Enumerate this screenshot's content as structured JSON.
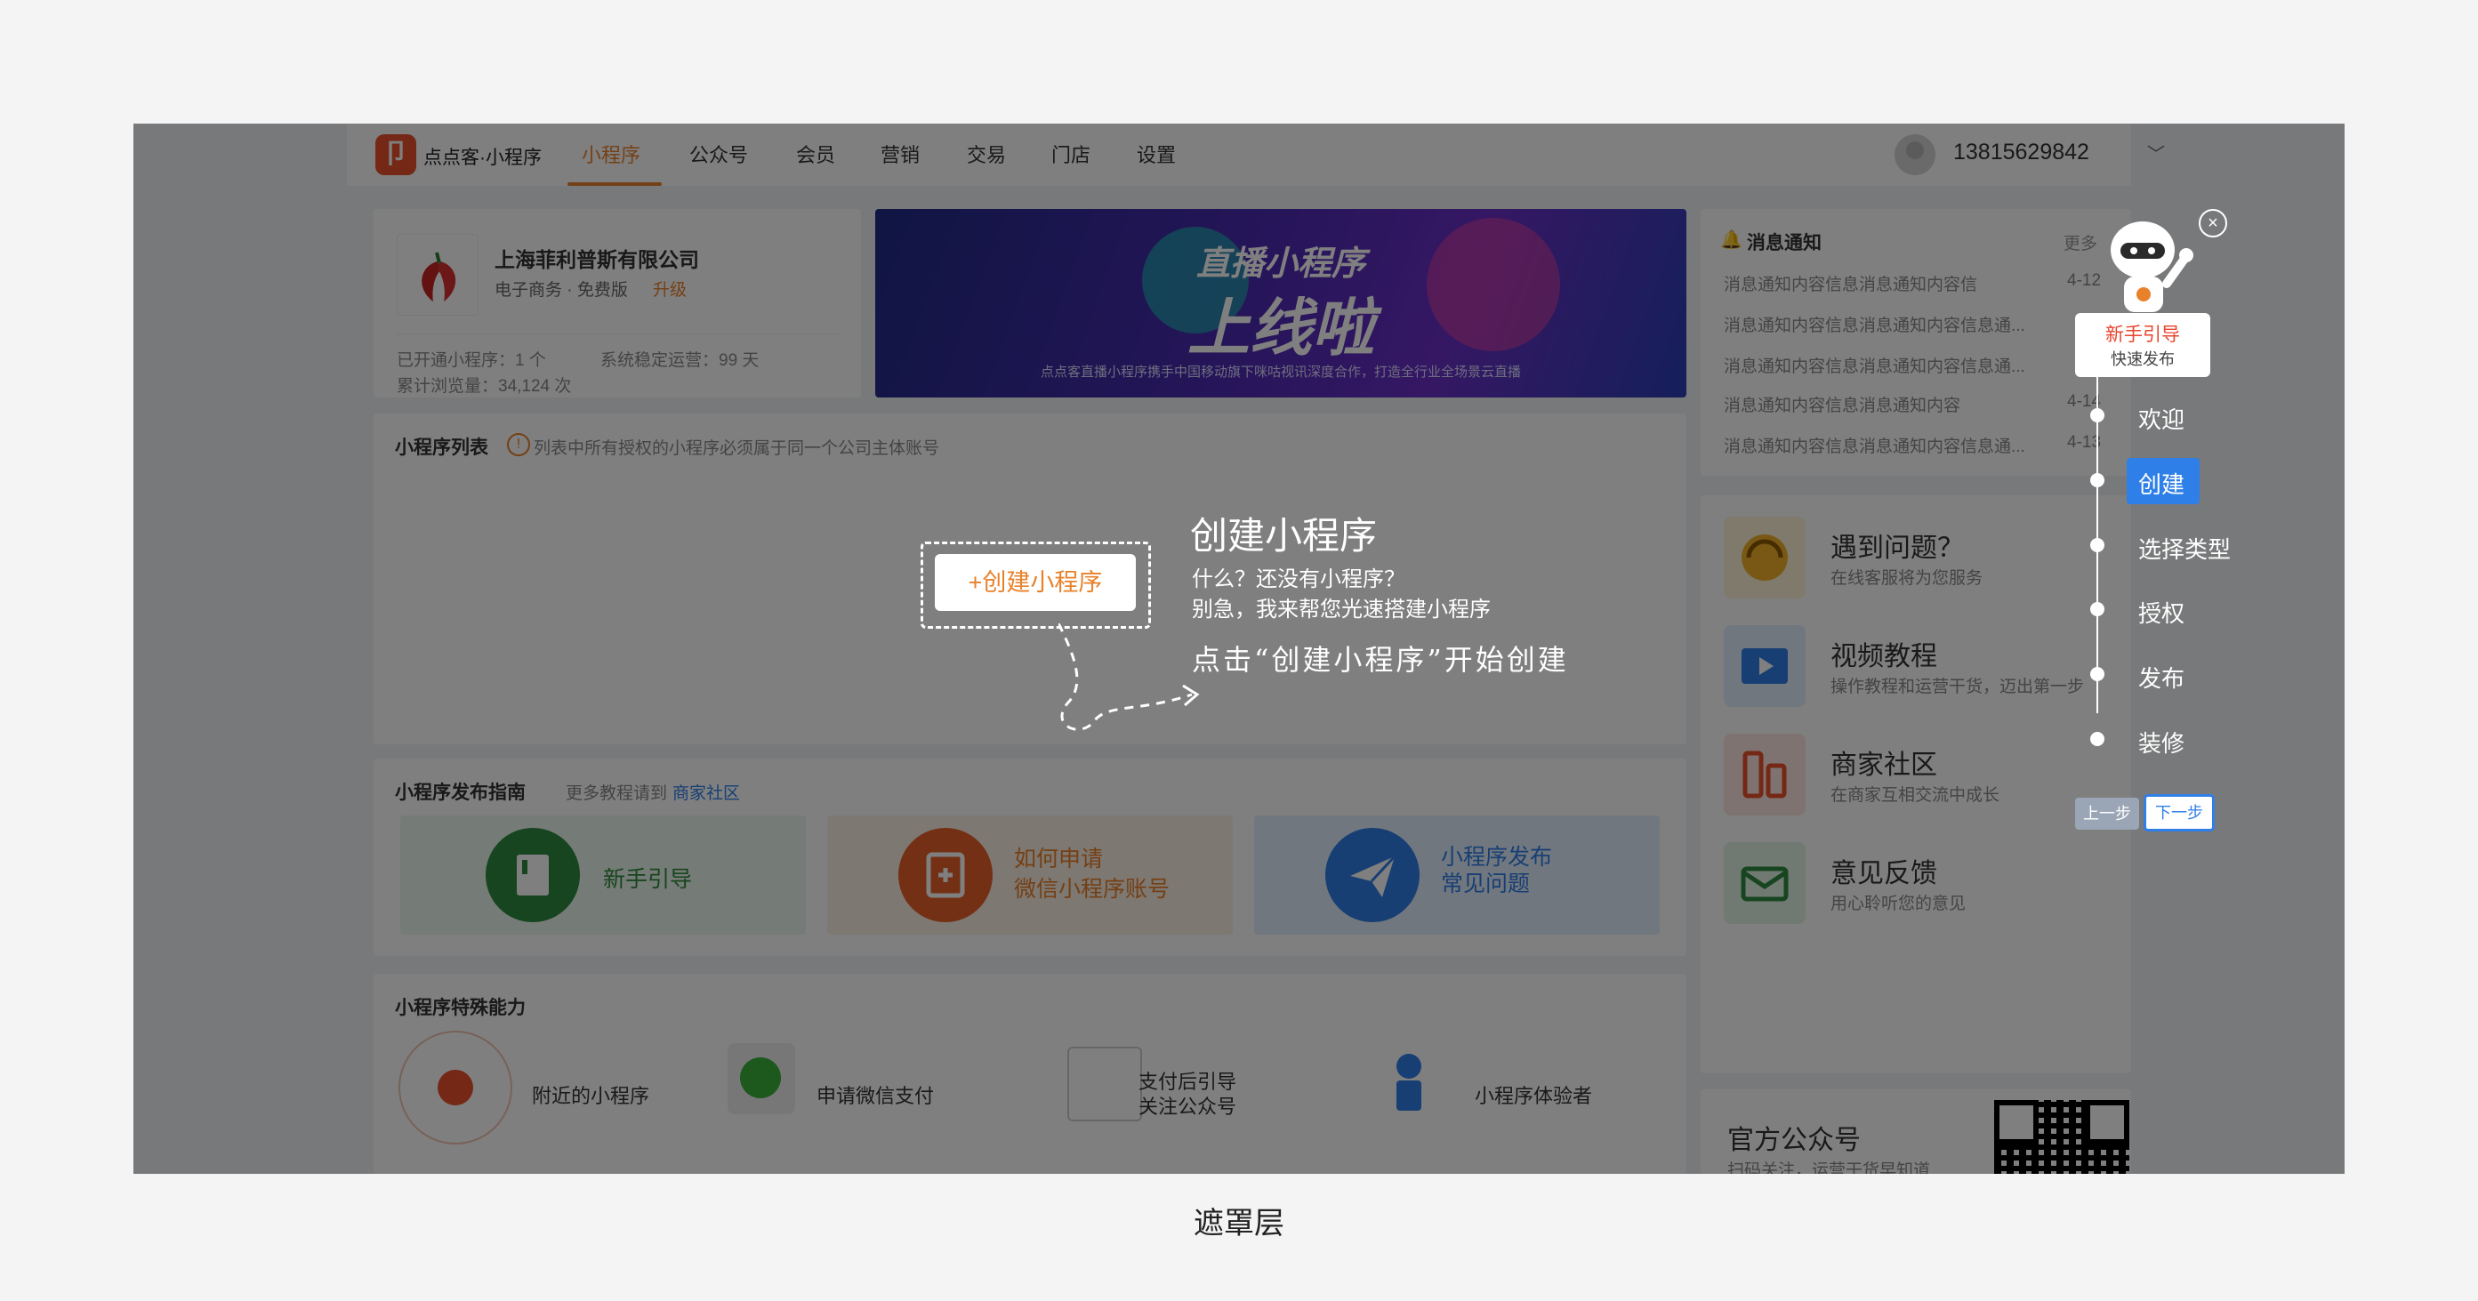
{
  "topnav": {
    "logo_glyph": "卩",
    "brand": "点点客·小程序",
    "items": [
      "小程序",
      "公众号",
      "会员",
      "营销",
      "交易",
      "门店",
      "设置"
    ],
    "active_item": "小程序",
    "phone": "13815629842",
    "dropdown_glyph": "﹀"
  },
  "company": {
    "name": "上海菲利普斯有限公司",
    "plan": "电子商务 · 免费版",
    "upgrade": "升级",
    "stats_line1": "已开通小程序：1 个",
    "stats_line1b": "系统稳定运营：99 天",
    "stats_line2": "累计浏览量：34,124 次"
  },
  "banner": {
    "title1": "直播小程序",
    "title2": "上线啦",
    "subtitle": "点点客直播小程序携手中国移动旗下咪咕视讯深度合作，打造全行业全场景云直播"
  },
  "notices": {
    "title": "消息通知",
    "more": "更多",
    "items": [
      {
        "text": "消息通知内容信息消息通知内容信",
        "date": "4-12"
      },
      {
        "text": "消息通知内容信息消息通知内容信息通...",
        "date": ""
      },
      {
        "text": "消息通知内容信息消息通知内容信息通...",
        "date": ""
      },
      {
        "text": "消息通知内容信息消息通知内容",
        "date": "4-14"
      },
      {
        "text": "消息通知内容信息消息通知内容信息通...",
        "date": "4-13"
      }
    ]
  },
  "mp_list": {
    "title": "小程序列表",
    "note": "列表中所有授权的小程序必须属于同一个公司主体账号"
  },
  "create": {
    "button": "+创建小程序",
    "title": "创建小程序",
    "line1": "什么？还没有小程序？",
    "line2": "别急，我来帮您光速搭建小程序",
    "hand": "点击“创建小程序”开始创建"
  },
  "guide": {
    "title": "小程序发布指南",
    "more_text": "更多教程请到",
    "more_link": "商家社区",
    "cards": [
      {
        "label": "新手引导",
        "color": "#2e8b3e"
      },
      {
        "label": "如何申请\n微信小程序账号",
        "color": "#e8812a"
      },
      {
        "label": "小程序发布\n常见问题",
        "color": "#2f7fe8"
      }
    ]
  },
  "abilities": {
    "title": "小程序特殊能力",
    "items": [
      "附近的小程序",
      "申请微信支付",
      "支付后引导\n关注公众号",
      "小程序体验者"
    ]
  },
  "help": [
    {
      "title": "遇到问题？",
      "sub": "在线客服将为您服务",
      "icon": "headset-icon"
    },
    {
      "title": "视频教程",
      "sub": "操作教程和运营干货，迈出第一步",
      "icon": "video-icon"
    },
    {
      "title": "商家社区",
      "sub": "在商家互相交流中成长",
      "icon": "community-icon"
    },
    {
      "title": "意见反馈",
      "sub": "用心聆听您的意见",
      "icon": "feedback-icon"
    }
  ],
  "official": {
    "title": "官方公众号",
    "sub": "扫码关注，运营干货早知道"
  },
  "guide_popup": {
    "card_title": "新手引导",
    "card_sub": "快速发布",
    "close_glyph": "×",
    "steps": [
      "欢迎",
      "创建",
      "选择类型",
      "授权",
      "发布",
      "装修"
    ],
    "active_step": "创建",
    "prev": "上一步",
    "next": "下一步"
  },
  "caption": "遮罩层"
}
